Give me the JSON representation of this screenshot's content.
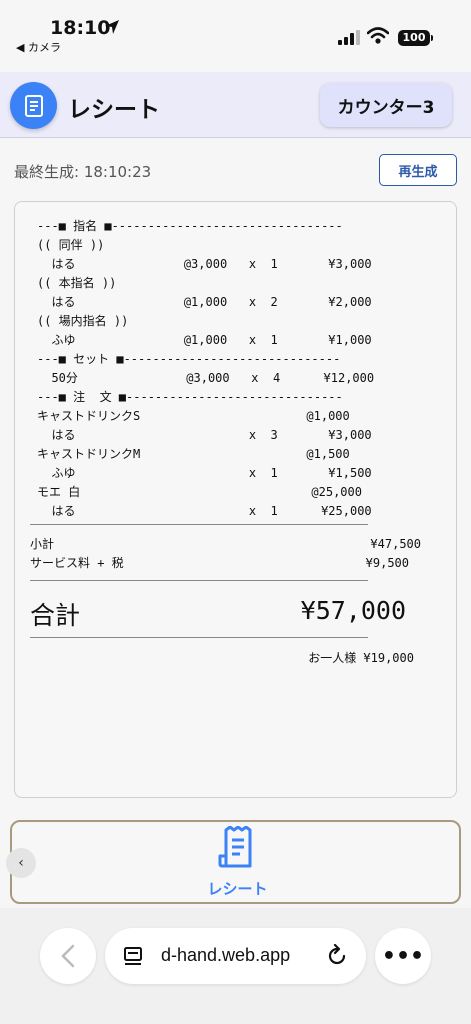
{
  "status_bar": {
    "time": "18:10",
    "back_label": "◀ カメラ",
    "battery": "100"
  },
  "header": {
    "title": "レシート",
    "counter_label": "カウンター3",
    "accent_color": "#3b82f6"
  },
  "last_generated": "最終生成: 18:10:23",
  "regenerate_label": "再生成",
  "receipt": {
    "lines": [
      "---■ 指名 ■--------------------------------",
      "(( 同伴 ))",
      "  はる               @3,000   x  1       ¥3,000",
      "(( 本指名 ))",
      "  はる               @1,000   x  2       ¥2,000",
      "(( 場内指名 ))",
      "  ふゆ               @1,000   x  1       ¥1,000",
      "---■ セット ■------------------------------",
      "  50分               @3,000   x  4      ¥12,000",
      "---■ 注  文 ■------------------------------",
      "キャストドリンクS                       @1,000",
      "  はる                        x  3       ¥3,000",
      "キャストドリンクM                       @1,500",
      "  ふゆ                        x  1       ¥1,500",
      "モエ 白                                @25,000",
      "  はる                        x  1      ¥25,000"
    ],
    "subtotal_label": "小計",
    "subtotal_value": "¥47,500",
    "service_label": "サービス料 + 税",
    "service_value": "¥9,500",
    "total_label": "合計",
    "total_value": "¥57,000",
    "per_person": "お一人様 ¥19,000"
  },
  "bottom_nav": {
    "collapse_glyph": "‹",
    "receipt_tab_label": "レシート"
  },
  "browser": {
    "url": "d-hand.web.app",
    "more_glyph": "•••"
  }
}
